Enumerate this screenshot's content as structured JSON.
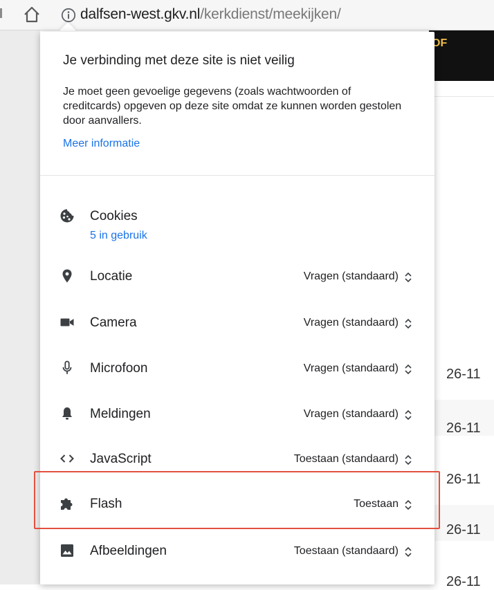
{
  "toolbar": {
    "url_host": "dalfsen-west.gkv.nl",
    "url_path": "/kerkdienst/meekijken/"
  },
  "page": {
    "banner_text": "OF",
    "dates": [
      "26-11",
      "26-11",
      "26-11",
      "26-11",
      "26-11"
    ]
  },
  "popup": {
    "title": "Je verbinding met deze site is niet veilig",
    "description": "Je moet geen gevoelige gegevens (zoals wachtwoorden of creditcards) opgeven op deze site omdat ze kunnen worden gestolen door aanvallers.",
    "more_info": "Meer informatie",
    "cookies": {
      "label": "Cookies",
      "sub": "5 in gebruik",
      "icon": "cookie-icon"
    },
    "permissions": [
      {
        "label": "Locatie",
        "value": "Vragen (standaard)",
        "icon": "location-pin-icon"
      },
      {
        "label": "Camera",
        "value": "Vragen (standaard)",
        "icon": "camera-icon"
      },
      {
        "label": "Microfoon",
        "value": "Vragen (standaard)",
        "icon": "microphone-icon"
      },
      {
        "label": "Meldingen",
        "value": "Vragen (standaard)",
        "icon": "bell-icon"
      },
      {
        "label": "JavaScript",
        "value": "Toestaan (standaard)",
        "icon": "code-icon"
      },
      {
        "label": "Flash",
        "value": "Toestaan",
        "icon": "puzzle-icon"
      },
      {
        "label": "Afbeeldingen",
        "value": "Toestaan (standaard)",
        "icon": "image-icon"
      }
    ]
  },
  "colors": {
    "link": "#1a73e8",
    "highlight_border": "#e2503f",
    "banner_bg": "#111111",
    "banner_text": "#f2c04a"
  }
}
